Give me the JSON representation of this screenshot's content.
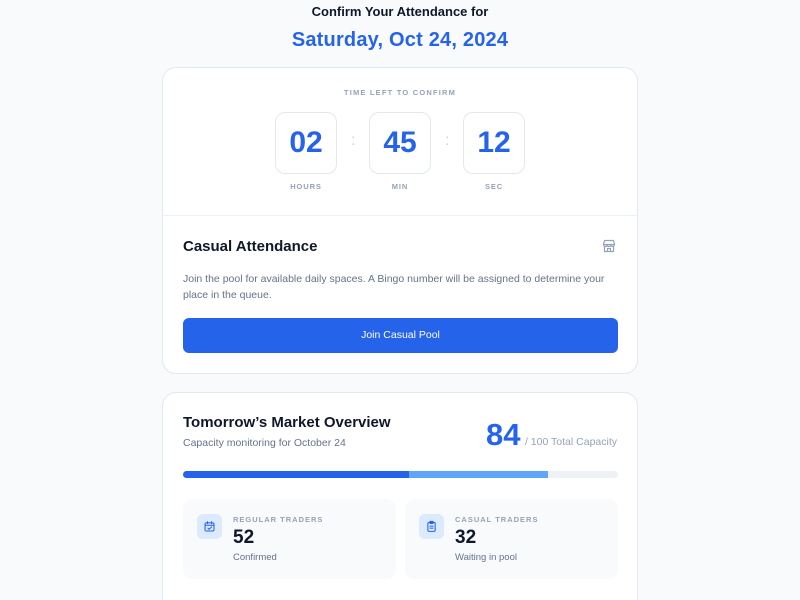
{
  "header": {
    "pretitle": "Confirm Your Attendance for",
    "date": "Saturday, Oct 24, 2024"
  },
  "timer": {
    "title": "TIME LEFT TO CONFIRM",
    "separator": ":",
    "units": [
      {
        "value": "02",
        "label": "HOURS"
      },
      {
        "value": "45",
        "label": "MIN"
      },
      {
        "value": "12",
        "label": "SEC"
      }
    ]
  },
  "casual": {
    "title": "Casual Attendance",
    "icon": "store-icon",
    "description": "Join the pool for available daily spaces. A Bingo number will be assigned to determine your place in the queue.",
    "button_label": "Join Casual Pool"
  },
  "overview": {
    "title": "Tomorrow’s Market Overview",
    "subtitle": "Capacity monitoring for October 24",
    "capacity_used": "84",
    "capacity_total": "/ 100 Total Capacity",
    "progress": {
      "regular_fraction": 0.52,
      "casual_fraction": 0.32
    },
    "stats": [
      {
        "icon": "calendar-check-icon",
        "label": "REGULAR TRADERS",
        "value": "52",
        "note": "Confirmed"
      },
      {
        "icon": "clipboard-icon",
        "label": "CASUAL TRADERS",
        "value": "32",
        "note": "Waiting in pool"
      }
    ]
  },
  "colors": {
    "accent": "#2563eb",
    "accent_light": "#60a5fa",
    "muted": "#94a3b8"
  }
}
